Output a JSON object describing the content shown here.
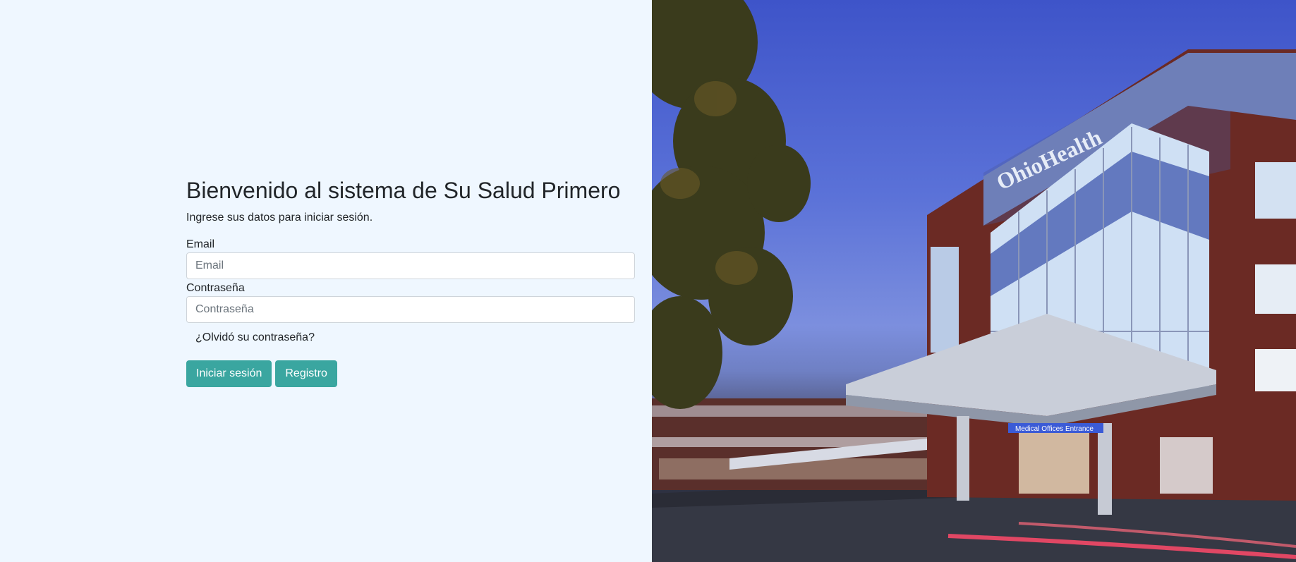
{
  "login": {
    "title": "Bienvenido al sistema de Su Salud Primero",
    "subtitle": "Ingrese sus datos para iniciar sesión.",
    "email": {
      "label": "Email",
      "placeholder": "Email",
      "value": ""
    },
    "password": {
      "label": "Contraseña",
      "placeholder": "Contraseña",
      "value": ""
    },
    "forgot_link": "¿Olvidó su contraseña?",
    "login_button": "Iniciar sesión",
    "register_button": "Registro"
  },
  "hero": {
    "building_sign": "OhioHealth",
    "entrance_sign": "Medical Offices Entrance"
  },
  "colors": {
    "left_background": "#eff7ff",
    "button": "#3aa6a0",
    "text": "#212529"
  }
}
